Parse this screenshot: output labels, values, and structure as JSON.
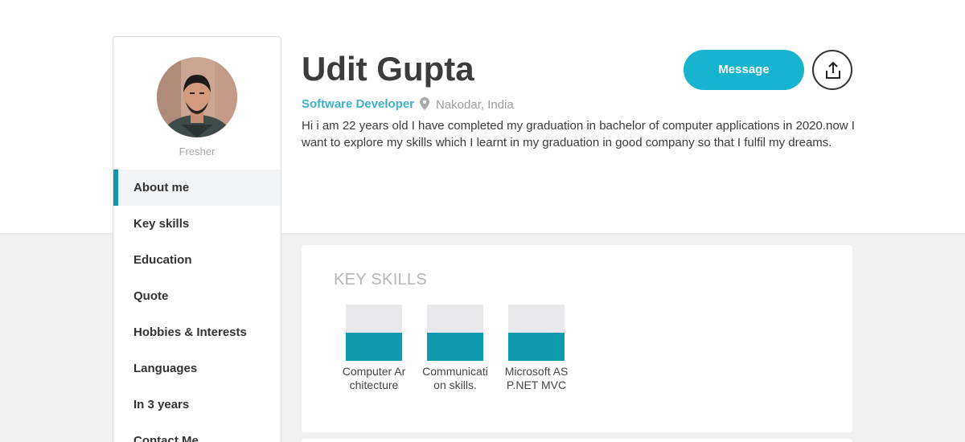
{
  "profile": {
    "name": "Udit Gupta",
    "role": "Software Developer",
    "location": "Nakodar, India",
    "status": "Fresher",
    "about": "Hi i am 22 years old I have completed my graduation in bachelor of computer applications in 2020.now I want to explore my skills which I learnt in my graduation in good company so that I fulfil my dreams."
  },
  "actions": {
    "message_label": "Message",
    "share_icon": "share-upload-icon"
  },
  "sidebar": {
    "items": [
      {
        "label": "About me",
        "active": true
      },
      {
        "label": "Key skills",
        "active": false
      },
      {
        "label": "Education",
        "active": false
      },
      {
        "label": "Quote",
        "active": false
      },
      {
        "label": "Hobbies & Interests",
        "active": false
      },
      {
        "label": "Languages",
        "active": false
      },
      {
        "label": "In 3 years",
        "active": false
      },
      {
        "label": "Contact Me",
        "active": false
      }
    ]
  },
  "key_skills": {
    "title": "KEY SKILLS",
    "skills": [
      {
        "label": "Computer Architecture",
        "level": 0.5
      },
      {
        "label": "Communication skills.",
        "level": 0.5
      },
      {
        "label": "Microsoft ASP.NET MVC",
        "level": 0.5
      }
    ]
  },
  "colors": {
    "accent": "#17b3cf",
    "accent_dark": "#0f9aad",
    "role_text": "#3fb0c6"
  }
}
